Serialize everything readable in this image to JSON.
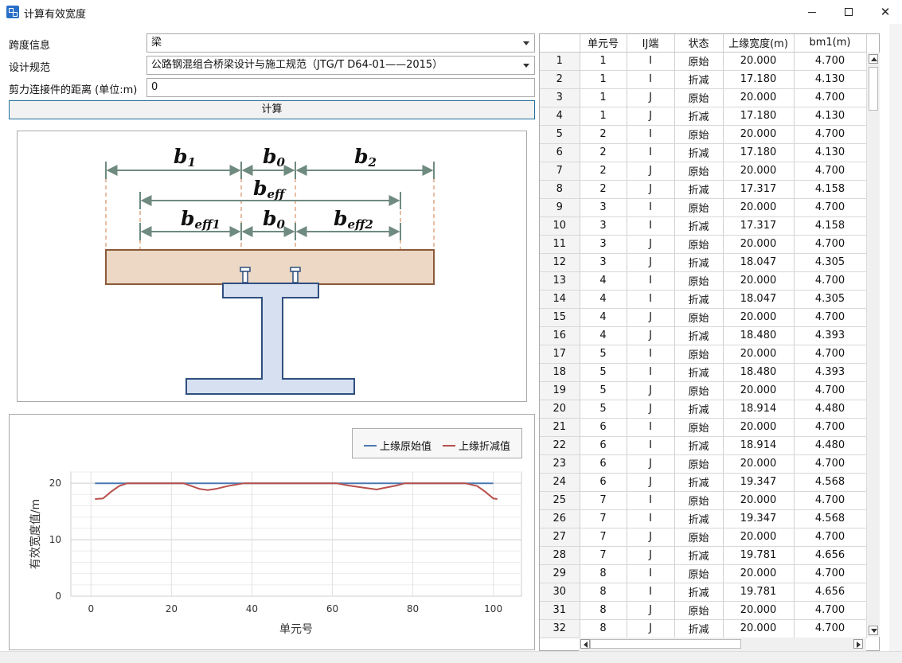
{
  "window": {
    "title": "计算有效宽度"
  },
  "form": {
    "span_label": "跨度信息",
    "span_value": "梁",
    "spec_label": "设计规范",
    "spec_value": "公路钢混组合桥梁设计与施工规范（JTG/T D64-01——2015）",
    "distance_label": "剪力连接件的距离 (单位:m)",
    "distance_value": "0",
    "calc_button": "计算"
  },
  "diagram": {
    "colors": {
      "slab_fill": "#ecd8c4",
      "slab_stroke": "#8a5a3a",
      "dim": "#6f8a7f",
      "steel_fill": "#d6e0f1",
      "steel_stroke": "#2f4f7f",
      "dash": "#d99a70"
    }
  },
  "chart_data": {
    "type": "line",
    "title": "",
    "xlabel": "单元号",
    "ylabel": "有效宽度值/m",
    "xlim": [
      -5,
      107
    ],
    "ylim": [
      0,
      22
    ],
    "xticks": [
      0,
      20,
      40,
      60,
      80,
      100
    ],
    "yticks": [
      0,
      10,
      20
    ],
    "legend_position": "top-right",
    "grid": true,
    "series": [
      {
        "name": "上缘原始值",
        "color": "#4a79b0",
        "points": [
          [
            1,
            20
          ],
          [
            100,
            20
          ]
        ]
      },
      {
        "name": "上缘折减值",
        "color": "#b6504c",
        "points": [
          [
            1,
            17.2
          ],
          [
            3,
            17.3
          ],
          [
            5,
            18.5
          ],
          [
            7,
            19.5
          ],
          [
            9,
            20
          ],
          [
            23,
            20
          ],
          [
            25,
            19.5
          ],
          [
            27,
            19
          ],
          [
            29,
            18.8
          ],
          [
            31,
            19
          ],
          [
            34,
            19.5
          ],
          [
            38,
            20
          ],
          [
            61,
            20
          ],
          [
            64,
            19.6
          ],
          [
            68,
            19.2
          ],
          [
            71,
            18.9
          ],
          [
            73,
            19.2
          ],
          [
            76,
            19.6
          ],
          [
            78,
            20
          ],
          [
            93,
            20
          ],
          [
            96,
            19.5
          ],
          [
            98,
            18.5
          ],
          [
            100,
            17.3
          ],
          [
            101,
            17.2
          ]
        ]
      }
    ]
  },
  "grid": {
    "columns": [
      "",
      "单元号",
      "IJ端",
      "状态",
      "上缘宽度(m)",
      "bm1(m)"
    ],
    "rows": [
      [
        "1",
        "1",
        "I",
        "原始",
        "20.000",
        "4.700"
      ],
      [
        "2",
        "1",
        "I",
        "折减",
        "17.180",
        "4.130"
      ],
      [
        "3",
        "1",
        "J",
        "原始",
        "20.000",
        "4.700"
      ],
      [
        "4",
        "1",
        "J",
        "折减",
        "17.180",
        "4.130"
      ],
      [
        "5",
        "2",
        "I",
        "原始",
        "20.000",
        "4.700"
      ],
      [
        "6",
        "2",
        "I",
        "折减",
        "17.180",
        "4.130"
      ],
      [
        "7",
        "2",
        "J",
        "原始",
        "20.000",
        "4.700"
      ],
      [
        "8",
        "2",
        "J",
        "折减",
        "17.317",
        "4.158"
      ],
      [
        "9",
        "3",
        "I",
        "原始",
        "20.000",
        "4.700"
      ],
      [
        "10",
        "3",
        "I",
        "折减",
        "17.317",
        "4.158"
      ],
      [
        "11",
        "3",
        "J",
        "原始",
        "20.000",
        "4.700"
      ],
      [
        "12",
        "3",
        "J",
        "折减",
        "18.047",
        "4.305"
      ],
      [
        "13",
        "4",
        "I",
        "原始",
        "20.000",
        "4.700"
      ],
      [
        "14",
        "4",
        "I",
        "折减",
        "18.047",
        "4.305"
      ],
      [
        "15",
        "4",
        "J",
        "原始",
        "20.000",
        "4.700"
      ],
      [
        "16",
        "4",
        "J",
        "折减",
        "18.480",
        "4.393"
      ],
      [
        "17",
        "5",
        "I",
        "原始",
        "20.000",
        "4.700"
      ],
      [
        "18",
        "5",
        "I",
        "折减",
        "18.480",
        "4.393"
      ],
      [
        "19",
        "5",
        "J",
        "原始",
        "20.000",
        "4.700"
      ],
      [
        "20",
        "5",
        "J",
        "折减",
        "18.914",
        "4.480"
      ],
      [
        "21",
        "6",
        "I",
        "原始",
        "20.000",
        "4.700"
      ],
      [
        "22",
        "6",
        "I",
        "折减",
        "18.914",
        "4.480"
      ],
      [
        "23",
        "6",
        "J",
        "原始",
        "20.000",
        "4.700"
      ],
      [
        "24",
        "6",
        "J",
        "折减",
        "19.347",
        "4.568"
      ],
      [
        "25",
        "7",
        "I",
        "原始",
        "20.000",
        "4.700"
      ],
      [
        "26",
        "7",
        "I",
        "折减",
        "19.347",
        "4.568"
      ],
      [
        "27",
        "7",
        "J",
        "原始",
        "20.000",
        "4.700"
      ],
      [
        "28",
        "7",
        "J",
        "折减",
        "19.781",
        "4.656"
      ],
      [
        "29",
        "8",
        "I",
        "原始",
        "20.000",
        "4.700"
      ],
      [
        "30",
        "8",
        "I",
        "折减",
        "19.781",
        "4.656"
      ],
      [
        "31",
        "8",
        "J",
        "原始",
        "20.000",
        "4.700"
      ],
      [
        "32",
        "8",
        "J",
        "折减",
        "20.000",
        "4.700"
      ]
    ]
  }
}
